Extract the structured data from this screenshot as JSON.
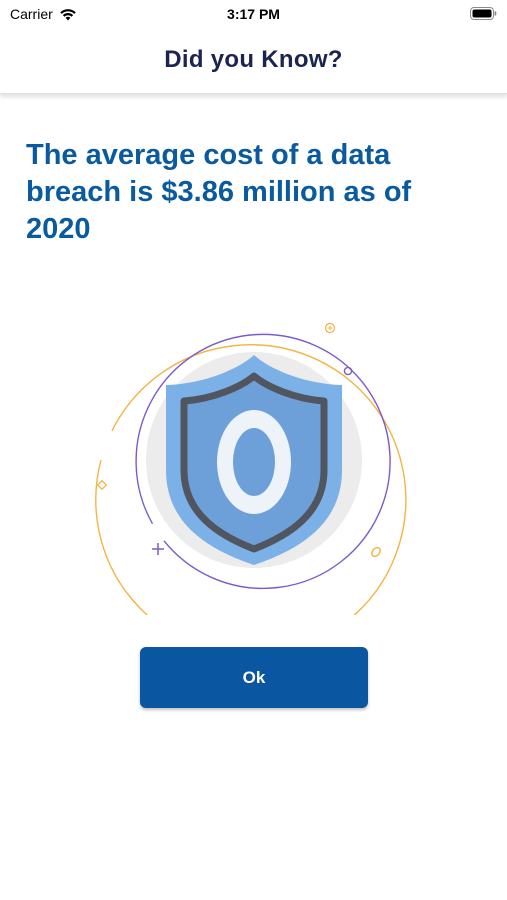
{
  "status_bar": {
    "carrier": "Carrier",
    "time": "3:17 PM"
  },
  "header": {
    "title": "Did you Know?"
  },
  "fact": {
    "text": "The average cost of a data breach is $3.86 million as of 2020"
  },
  "illustration": {
    "icon": "shield-icon",
    "glyph": "0"
  },
  "actions": {
    "ok_label": "Ok"
  },
  "colors": {
    "title": "#1c2450",
    "fact": "#0a5aa0",
    "button": "#0a56a0",
    "shield_fill": "#7cb1e8",
    "shield_outline": "#505560",
    "orange_ring": "#f2b443",
    "purple_ring": "#7b5cc9"
  }
}
